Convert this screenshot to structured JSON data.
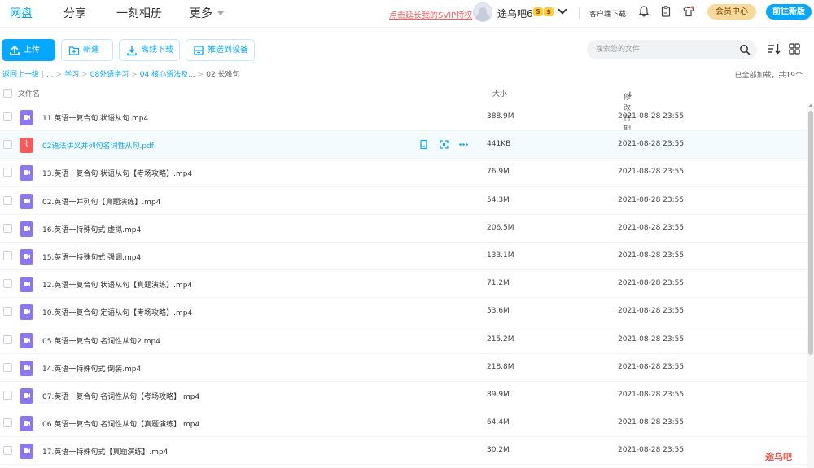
{
  "nav": {
    "tabs": [
      "网盘",
      "分享",
      "一刻相册",
      "更多"
    ],
    "promo": "点击延长我的SVIP特权",
    "username": "途乌吧6",
    "coin1": "S",
    "coin2": "$",
    "client_download": "客户端下载",
    "vip_center": "会员中心",
    "new_version": "前往新版"
  },
  "toolbar": {
    "upload": "上传",
    "new": "新建",
    "offline": "离线下载",
    "push": "推送到设备",
    "search_placeholder": "搜索您的文件"
  },
  "breadcrumb": {
    "back": "返回上一级",
    "ellipsis": "...",
    "items": [
      "学习",
      "08外语学习",
      "04 核心语法及...",
      "02 长难句"
    ],
    "loaded_text": "已全部加载，共19个"
  },
  "table": {
    "col_name": "文件名",
    "col_size": "大小",
    "col_date": "修改日期",
    "rows": [
      {
        "name": "11.英语一复合句 状语从句.mp4",
        "size": "388.9M",
        "date": "2021-08-28 23:55",
        "type": "video"
      },
      {
        "name": "02语法讲义并列句名词性从句.pdf",
        "size": "441KB",
        "date": "2021-08-28 23:55",
        "type": "pdf"
      },
      {
        "name": "13.英语一复合句 状语从句【考场攻略】.mp4",
        "size": "76.9M",
        "date": "2021-08-28 23:55",
        "type": "video"
      },
      {
        "name": "02.英语一并列句【真题演练】.mp4",
        "size": "54.3M",
        "date": "2021-08-28 23:55",
        "type": "video"
      },
      {
        "name": "16.英语一特殊句式 虚拟.mp4",
        "size": "206.5M",
        "date": "2021-08-28 23:55",
        "type": "video"
      },
      {
        "name": "15.英语一特殊句式 强调.mp4",
        "size": "133.1M",
        "date": "2021-08-28 23:55",
        "type": "video"
      },
      {
        "name": "12.英语一复合句 状语从句【真题演练】.mp4",
        "size": "71.2M",
        "date": "2021-08-28 23:55",
        "type": "video"
      },
      {
        "name": "10.英语一复合句 定语从句【考场攻略】.mp4",
        "size": "53.6M",
        "date": "2021-08-28 23:55",
        "type": "video"
      },
      {
        "name": "05.英语一复合句 名词性从句2.mp4",
        "size": "215.2M",
        "date": "2021-08-28 23:55",
        "type": "video"
      },
      {
        "name": "14.英语一特殊句式 倒装.mp4",
        "size": "218.8M",
        "date": "2021-08-28 23:55",
        "type": "video"
      },
      {
        "name": "07.英语一复合句 名词性从句【考场攻略】.mp4",
        "size": "89.9M",
        "date": "2021-08-28 23:55",
        "type": "video"
      },
      {
        "name": "06.英语一复合句 名词性从句【真题演练】.mp4",
        "size": "64.4M",
        "date": "2021-08-28 23:55",
        "type": "video"
      },
      {
        "name": "17.英语一特殊句式【真题演练】.mp4",
        "size": "30.2M",
        "date": "2021-08-28 23:55",
        "type": "video"
      }
    ]
  },
  "watermark": "途乌吧",
  "colors": {
    "accent": "#06a7ff",
    "promo": "#f25d5d",
    "vip": "#f7d99c",
    "video_icon": "#8b78f0",
    "pdf_icon": "#f45b5b"
  }
}
